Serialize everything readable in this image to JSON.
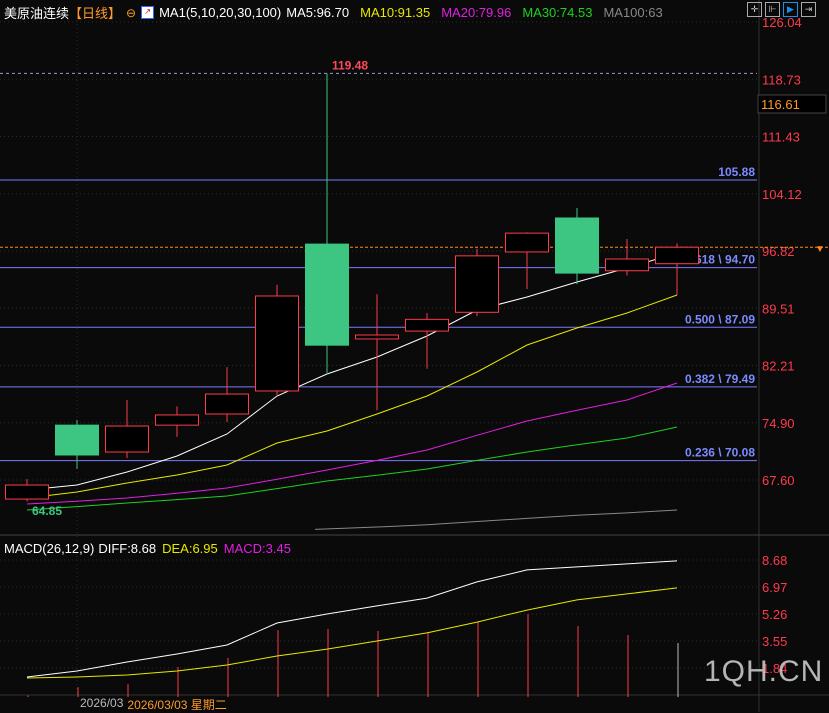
{
  "header": {
    "symbol": "美原油连续",
    "period": "【日线】",
    "period_icon": "zoom-out-circle-icon",
    "indicator_icon": "chart-icon",
    "ma_label": "MA1(5,10,20,30,100)",
    "ma5": "MA5:96.70",
    "ma10": "MA10:91.35",
    "ma20": "MA20:79.96",
    "ma30": "MA30:74.53",
    "ma100": "MA100:63"
  },
  "toolbar": [
    {
      "icon": "crosshair-icon"
    },
    {
      "icon": "range-icon"
    },
    {
      "icon": "play-right-icon",
      "active": true
    },
    {
      "icon": "exit-right-icon"
    }
  ],
  "price_axis": {
    "labels": [
      "126.04",
      "118.73",
      "111.43",
      "104.12",
      "96.82",
      "89.51",
      "82.21",
      "74.90",
      "67.60"
    ],
    "current_price": "116.61",
    "range": [
      67.6,
      126.04
    ]
  },
  "annotations": {
    "high": "119.48",
    "low": "64.85"
  },
  "fib_levels": [
    {
      "label": "105.88",
      "value": 105.88
    },
    {
      "label": "0.618 \\ 94.70",
      "value": 94.7
    },
    {
      "label": "0.500 \\ 87.09",
      "value": 87.09
    },
    {
      "label": "0.382 \\ 79.49",
      "value": 79.49
    },
    {
      "label": "0.236 \\ 70.08",
      "value": 70.08
    }
  ],
  "reference_line": 97.3,
  "colors": {
    "up": "#ff3a4c",
    "down": "#3cc681",
    "ma5": "#ffffff",
    "ma10": "#e8e800",
    "ma20": "#e020e0",
    "ma30": "#20d020",
    "ma100": "#888888",
    "fib": "#7b7bff",
    "axis_text": "#ff3a4c",
    "ref": "#ff8c1a"
  },
  "candles": [
    {
      "o": 65.17,
      "h": 67.73,
      "l": 64.85,
      "c": 66.96
    },
    {
      "o": 74.6,
      "h": 75.25,
      "l": 69.0,
      "c": 70.79
    },
    {
      "o": 71.17,
      "h": 77.8,
      "l": 70.4,
      "c": 74.49
    },
    {
      "o": 74.6,
      "h": 77.0,
      "l": 73.1,
      "c": 75.9
    },
    {
      "o": 76.02,
      "h": 82.0,
      "l": 75.0,
      "c": 78.57
    },
    {
      "o": 78.96,
      "h": 92.5,
      "l": 78.3,
      "c": 91.08
    },
    {
      "o": 97.7,
      "h": 119.48,
      "l": 81.1,
      "c": 84.8
    },
    {
      "o": 85.6,
      "h": 91.3,
      "l": 76.5,
      "c": 86.1
    },
    {
      "o": 86.6,
      "h": 88.9,
      "l": 81.8,
      "c": 88.1
    },
    {
      "o": 89.0,
      "h": 97.1,
      "l": 88.5,
      "c": 96.2
    },
    {
      "o": 96.7,
      "h": 99.2,
      "l": 91.97,
      "c": 99.1
    },
    {
      "o": 101.03,
      "h": 102.3,
      "l": 92.6,
      "c": 94.0
    },
    {
      "o": 94.3,
      "h": 98.35,
      "l": 93.7,
      "c": 95.8
    },
    {
      "o": 95.2,
      "h": 97.8,
      "l": 91.2,
      "c": 97.3
    }
  ],
  "ma": {
    "ma5": [
      66.32,
      66.96,
      68.62,
      70.66,
      73.47,
      78.32,
      81.13,
      83.3,
      85.98,
      89.29,
      90.95,
      92.87,
      94.65,
      96.57
    ],
    "ma10": [
      65.3,
      66.07,
      67.22,
      68.24,
      69.52,
      72.32,
      73.85,
      76.02,
      78.32,
      81.38,
      84.82,
      86.99,
      88.91,
      91.21
    ],
    "ma20": [
      64.54,
      64.9,
      65.3,
      65.9,
      66.58,
      67.7,
      68.88,
      70.1,
      71.43,
      73.3,
      75.13,
      76.5,
      77.81,
      79.98
    ],
    "ma30": [
      63.77,
      64.2,
      64.66,
      65.1,
      65.56,
      66.5,
      67.47,
      68.2,
      69.0,
      70.1,
      71.17,
      72.1,
      72.96,
      74.36
    ],
    "ma100": [
      null,
      null,
      null,
      null,
      null,
      null,
      61.3,
      61.6,
      61.9,
      62.3,
      62.7,
      63.1,
      63.4,
      63.77
    ]
  },
  "macd": {
    "label": "MACD(26,12,9)",
    "diff_label": "DIFF:8.68",
    "dea_label": "DEA:6.95",
    "macd_label": "MACD:3.45",
    "axis_labels": [
      "8.68",
      "6.97",
      "5.26",
      "3.55",
      "1.84"
    ],
    "diff": [
      1.27,
      1.65,
      2.22,
      2.73,
      3.3,
      4.69,
      5.26,
      5.77,
      6.27,
      7.29,
      8.05,
      8.24,
      8.43,
      8.62
    ],
    "dea": [
      1.21,
      1.27,
      1.4,
      1.65,
      2.03,
      2.6,
      3.04,
      3.55,
      4.06,
      4.75,
      5.51,
      6.15,
      6.53,
      6.91
    ],
    "hist": [
      0.1,
      0.63,
      0.82,
      1.9,
      2.47,
      4.24,
      4.31,
      4.18,
      4.12,
      4.75,
      5.26,
      4.5,
      3.93,
      3.42
    ]
  },
  "date_axis": {
    "month": "2026/03",
    "cursor_date": "2026/03/03 星期二"
  },
  "watermark": "1QH.CN"
}
